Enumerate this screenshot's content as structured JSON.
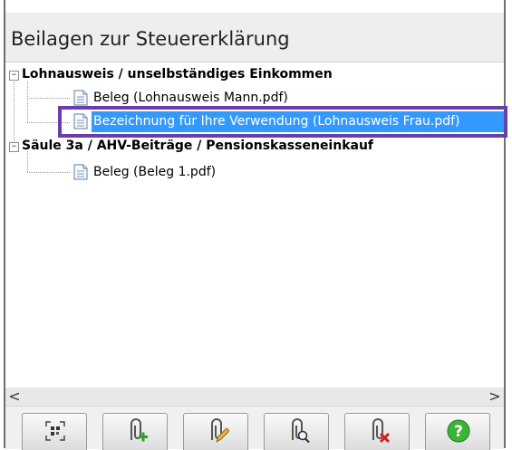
{
  "panel": {
    "title": "Beilagen zur Steuererklärung"
  },
  "tree": {
    "groups": [
      {
        "label": "Lohnausweis / unselbständiges Einkommen",
        "expander": "−",
        "items": [
          {
            "label": "Beleg (Lohnausweis Mann.pdf)"
          },
          {
            "label": "Bezeichnung für Ihre Verwendung (Lohnausweis Frau.pdf)",
            "selected": true
          }
        ]
      },
      {
        "label": "Säule 3a / AHV-Beiträge / Pensionskasseneinkauf",
        "expander": "−",
        "items": [
          {
            "label": "Beleg (Beleg 1.pdf)"
          }
        ]
      }
    ]
  },
  "scrollbar": {
    "left_arrow": "<",
    "right_arrow": ">"
  },
  "toolbar": {
    "buttons": [
      {
        "icon": "scan-qr-icon"
      },
      {
        "icon": "add-attachment-icon"
      },
      {
        "icon": "edit-attachment-icon"
      },
      {
        "icon": "view-attachment-icon"
      },
      {
        "icon": "delete-attachment-icon"
      },
      {
        "icon": "help-icon"
      }
    ]
  },
  "colors": {
    "selection": "#3399ff",
    "selection_outline": "#6a3da8",
    "header_bg": "#eeeeee",
    "help_green": "#3cb43c",
    "delete_red": "#d42020"
  }
}
